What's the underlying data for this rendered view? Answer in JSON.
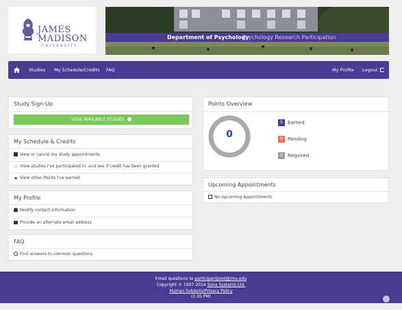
{
  "header": {
    "logo": {
      "line1": "JAMES",
      "line2": "MADISON",
      "line3": "UNIVERSITY."
    },
    "banner": {
      "dept": "Department of Psychology",
      "subtitle": "Psychology Research Participation"
    }
  },
  "nav": {
    "home_icon": "home-icon",
    "items": [
      {
        "label": "Studies"
      },
      {
        "label": "My Schedule/Credits"
      },
      {
        "label": "FAQ"
      }
    ],
    "right": {
      "profile": "My Profile",
      "logout": "Logout"
    }
  },
  "study_signup": {
    "title": "Study Sign-Up",
    "button": "VIEW AVAILABLE STUDIES"
  },
  "schedule": {
    "title": "My Schedule & Credits",
    "items": [
      {
        "icon": "checkbox-icon",
        "label": "View or cancel my study appointments"
      },
      {
        "icon": "star-half-icon",
        "label": "View studies I've participated in, and see if credit has been granted"
      },
      {
        "icon": "star-icon",
        "label": "View other Points I've earned"
      }
    ]
  },
  "profile": {
    "title": "My Profile",
    "items": [
      {
        "icon": "user-icon",
        "label": "Modify contact information"
      },
      {
        "icon": "envelope-icon",
        "label": "Provide an alternate email address"
      }
    ]
  },
  "faq": {
    "title": "FAQ",
    "items": [
      {
        "icon": "chat-icon",
        "label": "Find answers to common questions"
      }
    ]
  },
  "points": {
    "title": "Points Overview",
    "total": "0",
    "legend": [
      {
        "value": "0",
        "label": "Earned",
        "color": "#4b3c93"
      },
      {
        "value": "0",
        "label": "Pending",
        "color": "#e8735a"
      },
      {
        "value": "0",
        "label": "Required",
        "color": "#9e9e9e"
      }
    ]
  },
  "appointments": {
    "title": "Upcoming Appointments",
    "empty": "No Upcoming Appointments"
  },
  "footer": {
    "email_prefix": "Email questions to",
    "email": "participantpool@jmu.edu",
    "copyright_prefix": "Copyright © 1997-2014",
    "company": "Sona Systems Ltd.",
    "policy": "Human Subjects/Privacy Policy",
    "time": "(1:35 PM)"
  },
  "colors": {
    "brand_purple": "#4b3c93",
    "green": "#7bc75a",
    "ring_blue": "#1f4b9e"
  }
}
